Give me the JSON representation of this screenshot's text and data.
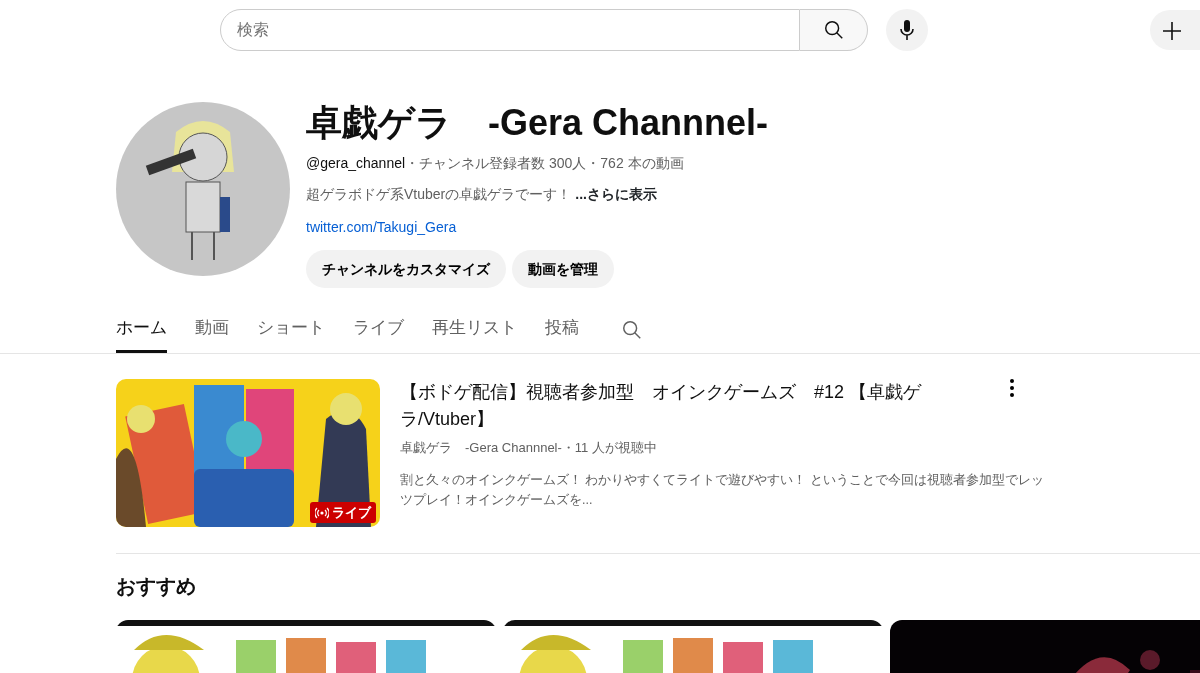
{
  "search": {
    "placeholder": "検索"
  },
  "channel": {
    "title": "卓戯ゲラ　-Gera Channnel-",
    "handle": "@gera_channel",
    "meta": "・チャンネル登録者数 300人・762 本の動画",
    "description": "超ゲラボドゲ系Vtuberの卓戯ゲラでーす！",
    "more": "...さらに表示",
    "link": "twitter.com/Takugi_Gera",
    "buttons": [
      "チャンネルをカスタマイズ",
      "動画を管理"
    ]
  },
  "tabs": [
    {
      "label": "ホーム",
      "selected": true
    },
    {
      "label": "動画",
      "selected": false
    },
    {
      "label": "ショート",
      "selected": false
    },
    {
      "label": "ライブ",
      "selected": false
    },
    {
      "label": "再生リスト",
      "selected": false
    },
    {
      "label": "投稿",
      "selected": false
    }
  ],
  "featured": {
    "title": "【ボドゲ配信】視聴者参加型　オインクゲームズ　#12 【卓戯ゲラ/Vtuber】",
    "meta": "卓戯ゲラ　-Gera Channnel-・11 人が視聴中",
    "description": "割と久々のオインクゲームズ！ わかりやすくてライトで遊びやすい！ ということで今回は視聴者参加型でレッツプレイ！オインクゲームズを...",
    "badge": "ライブ"
  },
  "recommended": {
    "heading": "おすすめ"
  }
}
